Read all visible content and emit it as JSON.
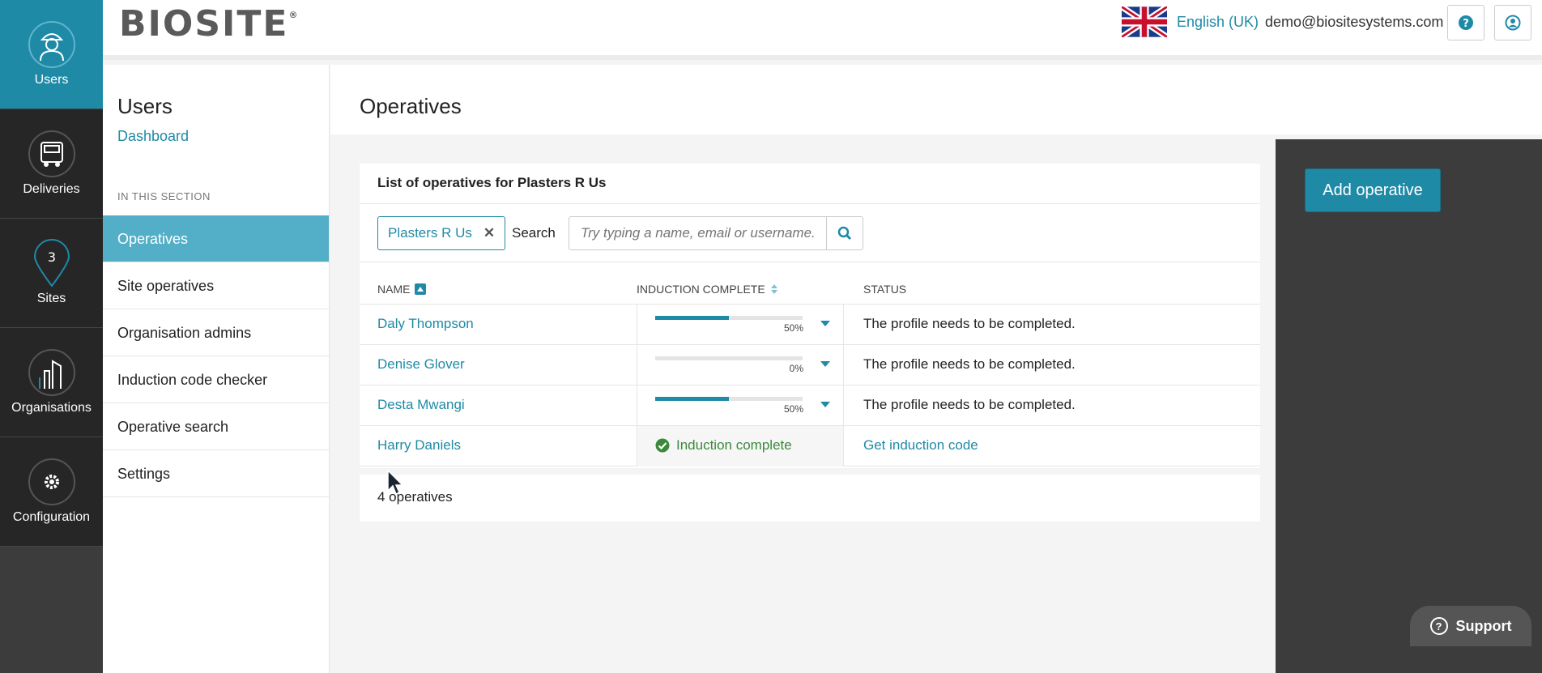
{
  "rail": [
    {
      "label": "Users",
      "icon": "worker-icon",
      "active": true
    },
    {
      "label": "Deliveries",
      "icon": "truck-icon",
      "active": false
    },
    {
      "label": "Sites",
      "icon": "map-pin-icon",
      "active": false
    },
    {
      "label": "Organisations",
      "icon": "building-icon",
      "active": false
    },
    {
      "label": "Configuration",
      "icon": "gear-icon",
      "active": false
    }
  ],
  "header": {
    "logo_text": "BIOSITE",
    "logo_mark": "®",
    "language": "English (UK)",
    "email": "demo@biositesystems.com"
  },
  "section": {
    "title": "Users",
    "dashboard_link": "Dashboard",
    "in_this_section": "IN THIS SECTION",
    "items": [
      {
        "label": "Operatives",
        "active": true
      },
      {
        "label": "Site operatives",
        "active": false
      },
      {
        "label": "Organisation admins",
        "active": false
      },
      {
        "label": "Induction code checker",
        "active": false
      },
      {
        "label": "Operative search",
        "active": false
      },
      {
        "label": "Settings",
        "active": false
      }
    ]
  },
  "main": {
    "title": "Operatives",
    "card_title": "List of operatives for Plasters R Us",
    "filter_chip": "Plasters R Us",
    "search_label": "Search",
    "search_placeholder": "Try typing a name, email or username...",
    "columns": {
      "name": "NAME",
      "induction": "INDUCTION COMPLETE",
      "status": "STATUS"
    },
    "rows": [
      {
        "name": "Daly Thompson",
        "progress": 0.5,
        "pct": "50%",
        "status": "The profile needs to be completed.",
        "complete": false
      },
      {
        "name": "Denise Glover",
        "progress": 0.0,
        "pct": "0%",
        "status": "The profile needs to be completed.",
        "complete": false
      },
      {
        "name": "Desta Mwangi",
        "progress": 0.5,
        "pct": "50%",
        "status": "The profile needs to be completed.",
        "complete": false
      },
      {
        "name": "Harry Daniels",
        "induction_text": "Induction complete",
        "status": "Get induction code",
        "complete": true
      }
    ],
    "count": "4 operatives"
  },
  "actions": {
    "add_operative": "Add operative",
    "support": "Support"
  },
  "colors": {
    "accent": "#1f8aa6",
    "rail_bg": "#262626",
    "active_nav": "#53aec7"
  }
}
